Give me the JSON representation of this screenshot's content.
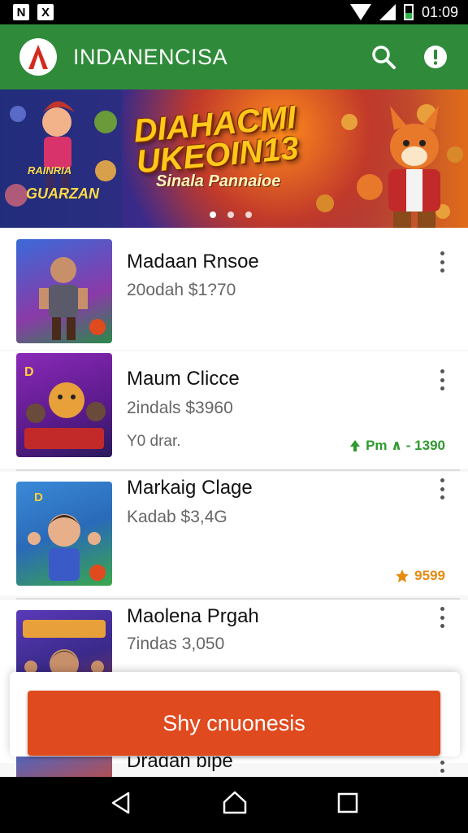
{
  "status_bar": {
    "left_icons": [
      "N",
      "X"
    ],
    "time": "01:09"
  },
  "app_bar": {
    "title": "INDANENCISA",
    "icons": [
      "logo-icon",
      "search-icon",
      "alert-icon"
    ]
  },
  "banner": {
    "title": "DIAHACMI UKEOIN13",
    "subtitle": "Sinala Pannaioe",
    "left_caption": "RAINRIA",
    "left_caption2": "GUARZAN",
    "pager_count": 3
  },
  "items": [
    {
      "name": "Madaan Rnsoe",
      "price": "20odah $1?70",
      "extra": "",
      "rating": ""
    },
    {
      "name": "Maum Clicce",
      "price": "2indals $3960",
      "extra": "Y0 drar.",
      "rating": "Pm ∧ - 1390"
    },
    {
      "name": "Markaig Clage",
      "price": "Kadab $3,4G",
      "extra": "",
      "rating": "9599"
    },
    {
      "name": "Maolena Prgah",
      "price": "7indas 3,050",
      "extra": "",
      "rating": ""
    },
    {
      "name": "Dradan bipe",
      "price": "",
      "extra": "",
      "rating": ""
    }
  ],
  "cta": {
    "label": "Shy cnuonesis"
  },
  "nav": {
    "icons": [
      "back-icon",
      "home-icon",
      "recents-icon"
    ]
  },
  "colors": {
    "appbar": "#2f8b3a",
    "cta": "#e04a1f",
    "rating_green": "#2f9a2f",
    "rating_orange": "#e78a10"
  }
}
